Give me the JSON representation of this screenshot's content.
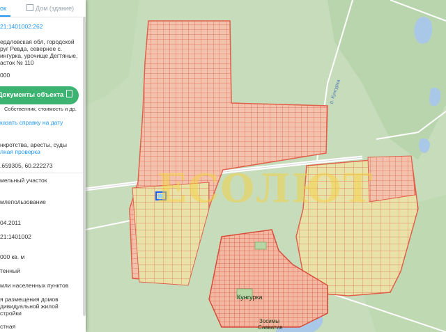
{
  "panel": {
    "tabs": [
      {
        "label": "ок"
      },
      {
        "label": "Дом (здание)"
      }
    ],
    "cadastral_number": "21:1401002:262",
    "address_lines": [
      "ердловская обл, городской",
      "руг Ревда, севернее с.",
      "ингурка, урочище Дегтяные,",
      "асток № 110"
    ],
    "value_1": "000",
    "documents_button": "Документы объекта",
    "documents_sub": "Собственник, стоимость и др.",
    "link_report": "казать справку на дату",
    "line_checks": "нкротства, аресты, суды",
    "link_full_check": "лная проверка",
    "coordinates": ".659305, 60.222273",
    "object_type": "мельный участок",
    "land_use": "млепользование",
    "date": "04.2011",
    "block_number": "21:1401002",
    "area": "000 кв. м",
    "status": "тенный",
    "category": "мли населенных пунктов",
    "purpose_lines": [
      "я размещения домов",
      "дивидуальной жилой",
      "стройки"
    ],
    "ownership": "стная"
  },
  "map": {
    "watermark": "ЕСОЛЮТ",
    "place_labels": [
      {
        "text": "Кунгурка"
      },
      {
        "text": "Зосимы"
      },
      {
        "text": "Савватия"
      },
      {
        "text": "р. Кунгурка"
      }
    ]
  }
}
